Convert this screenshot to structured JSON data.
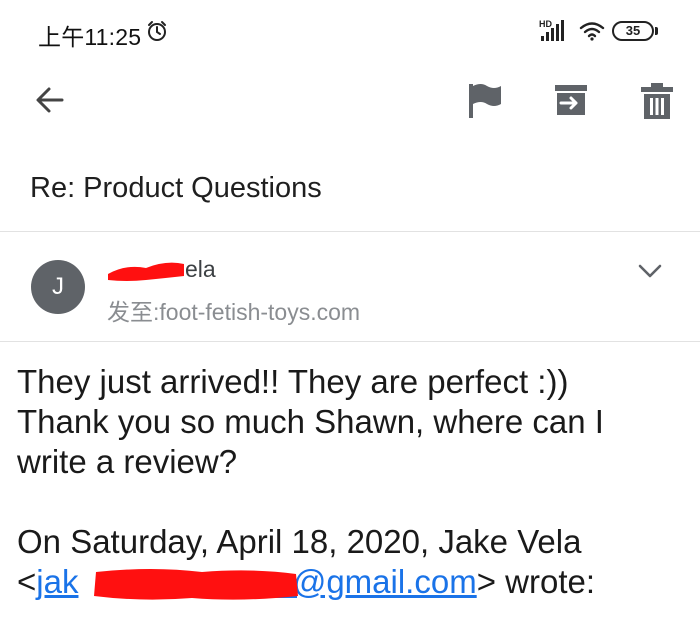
{
  "status_bar": {
    "time": "上午11:25",
    "network": "HD",
    "battery": "35"
  },
  "toolbar": {
    "back_icon": "arrow-back-icon",
    "flag_icon": "flag-icon",
    "archive_icon": "archive-icon",
    "delete_icon": "trash-icon"
  },
  "email": {
    "subject": "Re: Product Questions",
    "sender": {
      "avatar_initial": "J",
      "name_visible": "ela",
      "to_label": "发至:foot-fetish-toys.com"
    },
    "body_lines": [
      "They just arrived!! They are perfect :))",
      "Thank you so much Shawn, where can I",
      "write a review?"
    ],
    "quote": {
      "line1": "On Saturday, April 18, 2020, Jake Vela",
      "open_bracket": "<",
      "email_prefix": "jak",
      "email_suffix": "n@gmail.com",
      "close_wrote": "> wrote:"
    }
  },
  "colors": {
    "redaction": "#ff1010",
    "link": "#1a73e8",
    "avatar_bg": "#5f6368"
  }
}
